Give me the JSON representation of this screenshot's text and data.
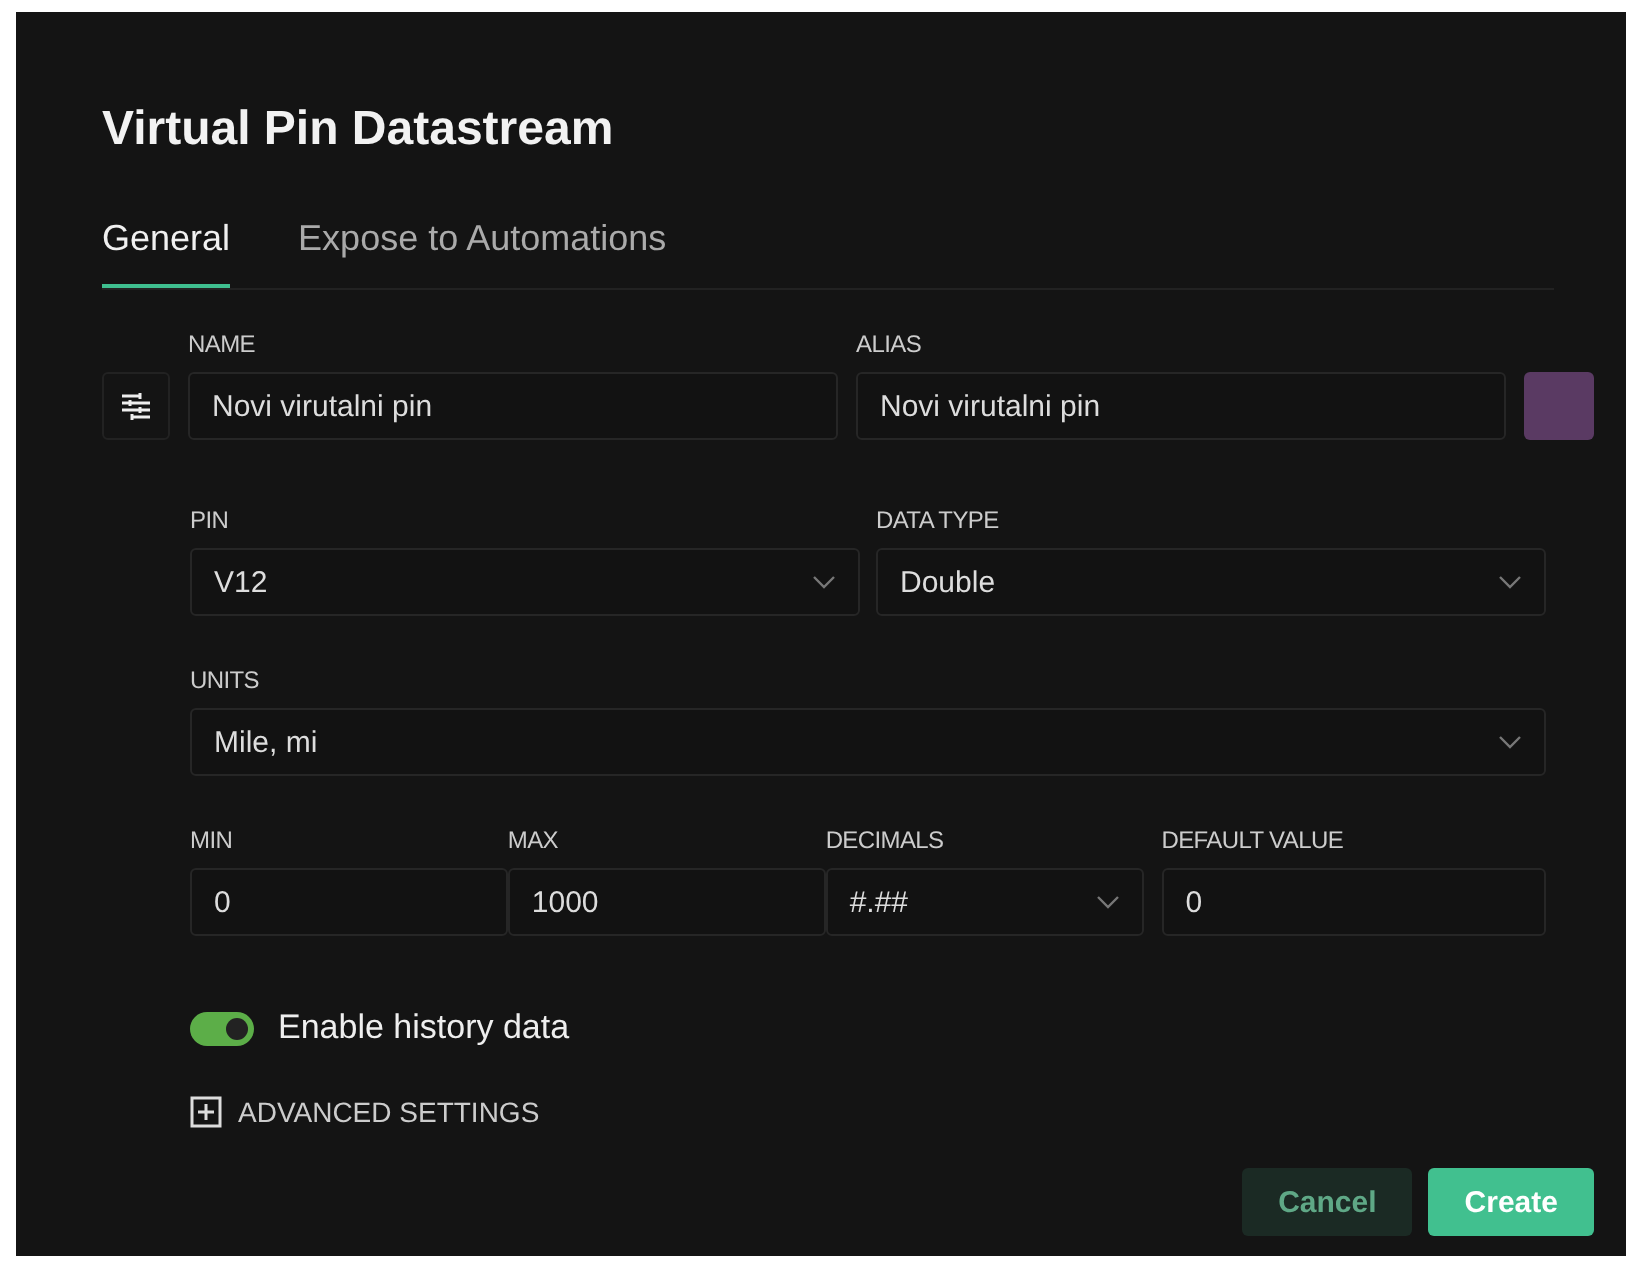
{
  "dialog": {
    "title": "Virtual Pin Datastream"
  },
  "tabs": [
    {
      "label": "General",
      "selected": true
    },
    {
      "label": "Expose to Automations",
      "selected": false
    }
  ],
  "name_field": {
    "label": "NAME",
    "value": "Novi virutalni pin"
  },
  "alias_field": {
    "label": "ALIAS",
    "value": "Novi virutalni pin",
    "color": "#5a3a63"
  },
  "pin_field": {
    "label": "PIN",
    "value": "V12"
  },
  "data_type_field": {
    "label": "DATA TYPE",
    "value": "Double"
  },
  "units_field": {
    "label": "UNITS",
    "value": "Mile, mi"
  },
  "range_fields": [
    {
      "label": "MIN",
      "value": "0",
      "kind": "input"
    },
    {
      "label": "MAX",
      "value": "1000",
      "kind": "input"
    },
    {
      "label": "DECIMALS",
      "value": "#.##",
      "kind": "select"
    },
    {
      "label": "DEFAULT VALUE",
      "value": "0",
      "kind": "input"
    }
  ],
  "history_toggle": {
    "label": "Enable history data",
    "on": true
  },
  "advanced_settings": {
    "label": "ADVANCED SETTINGS",
    "expanded": false
  },
  "buttons": [
    {
      "label": "Cancel",
      "kind": "secondary"
    },
    {
      "label": "Create",
      "kind": "primary"
    }
  ]
}
